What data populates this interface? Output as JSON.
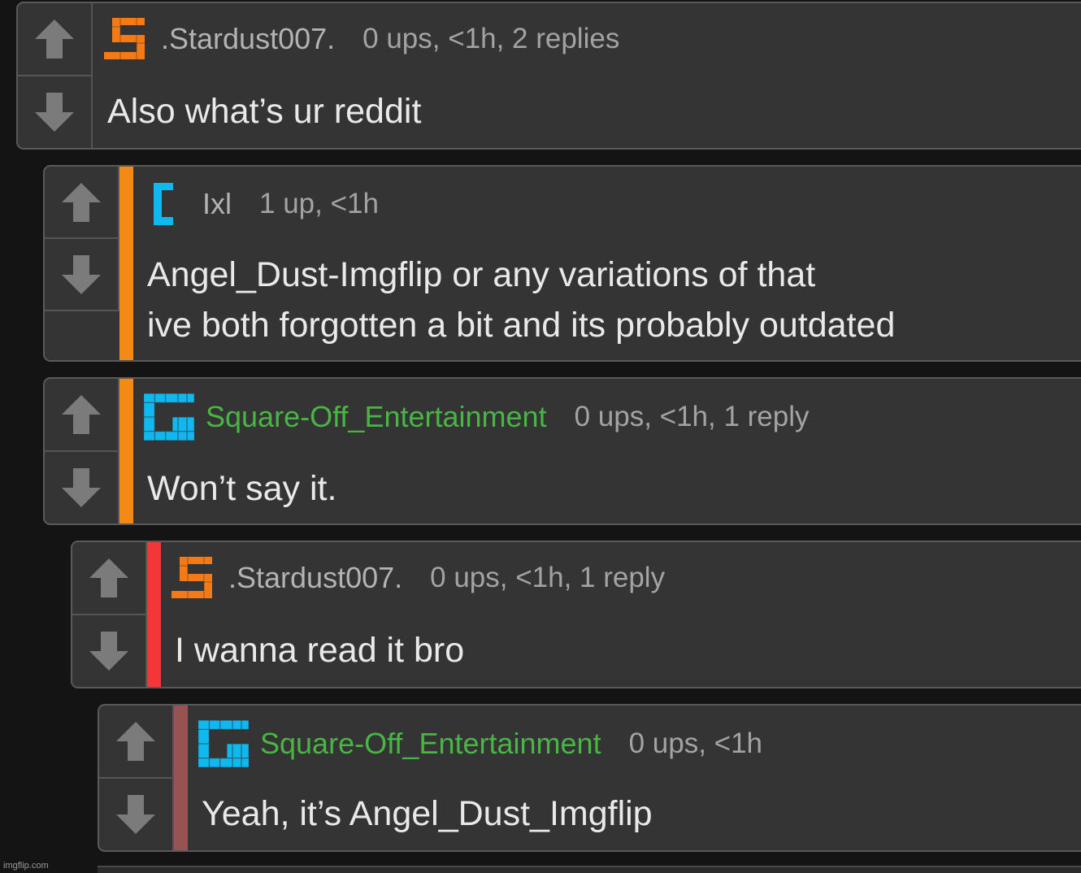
{
  "colors": {
    "background": "#141414",
    "panel": "#343434",
    "username_default": "#b3b3b3",
    "username_green": "#49b544",
    "bar_orange": "#f28a14",
    "bar_red": "#f43636",
    "bar_maroon": "#975252",
    "avatar_orange": "#f37a14",
    "avatar_blue": "#10b8f0"
  },
  "icons": {
    "upvote": "arrow-up-icon",
    "downvote": "arrow-down-icon"
  },
  "comments": [
    {
      "username": ".Stardust007.",
      "meta": "0 ups, <1h, 2 replies",
      "text": [
        "Also what’s ur reddit"
      ],
      "avatar": "orange-s-avatar"
    },
    {
      "username": "Ixl",
      "meta": "1 up, <1h",
      "text": [
        "Angel_Dust-Imgflip or any variations of that",
        "ive both forgotten a bit and its probably outdated"
      ],
      "avatar": "blue-c-avatar"
    },
    {
      "username": "Square-Off_Entertainment",
      "meta": "0 ups, <1h, 1 reply",
      "text": [
        "Won’t say it."
      ],
      "avatar": "blue-g-avatar"
    },
    {
      "username": ".Stardust007.",
      "meta": "0 ups, <1h, 1 reply",
      "text": [
        "I wanna read it bro"
      ],
      "avatar": "orange-s-avatar"
    },
    {
      "username": "Square-Off_Entertainment",
      "meta": "0 ups, <1h",
      "text": [
        "Yeah, it’s Angel_Dust_Imgflip"
      ],
      "avatar": "blue-g-avatar"
    }
  ],
  "watermark": "imgflip.com"
}
